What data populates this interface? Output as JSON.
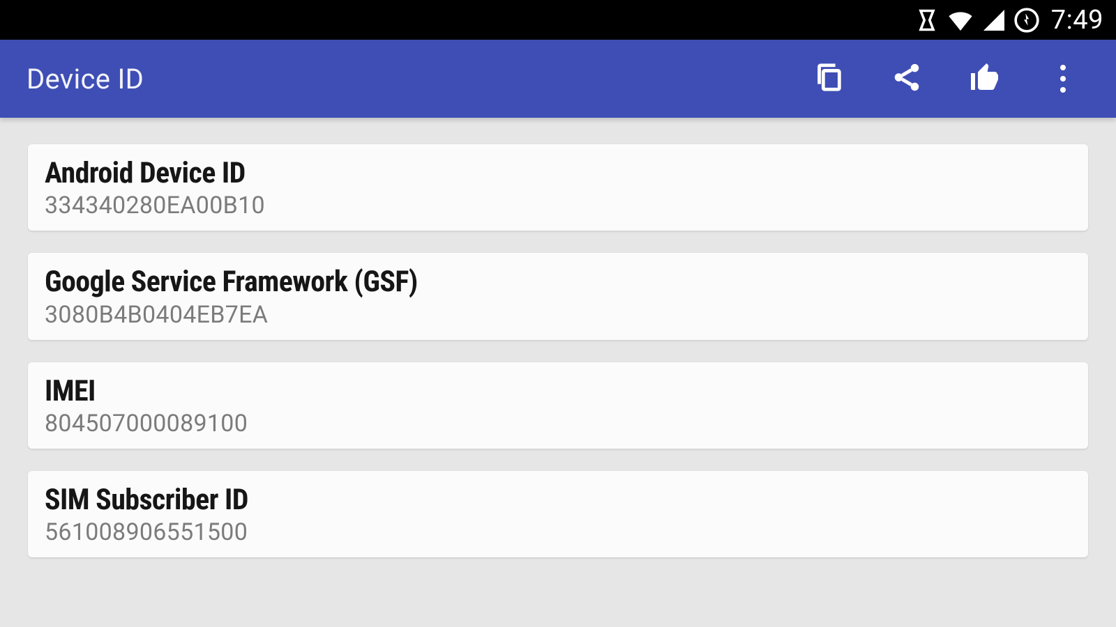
{
  "statusbar": {
    "time": "7:49"
  },
  "appbar": {
    "title": "Device ID"
  },
  "items": [
    {
      "title": "Android Device ID",
      "value": "334340280EA00B10"
    },
    {
      "title": "Google Service Framework (GSF)",
      "value": "3080B4B0404EB7EA"
    },
    {
      "title": "IMEI",
      "value": "804507000089100"
    },
    {
      "title": "SIM Subscriber ID",
      "value": "561008906551500"
    }
  ]
}
